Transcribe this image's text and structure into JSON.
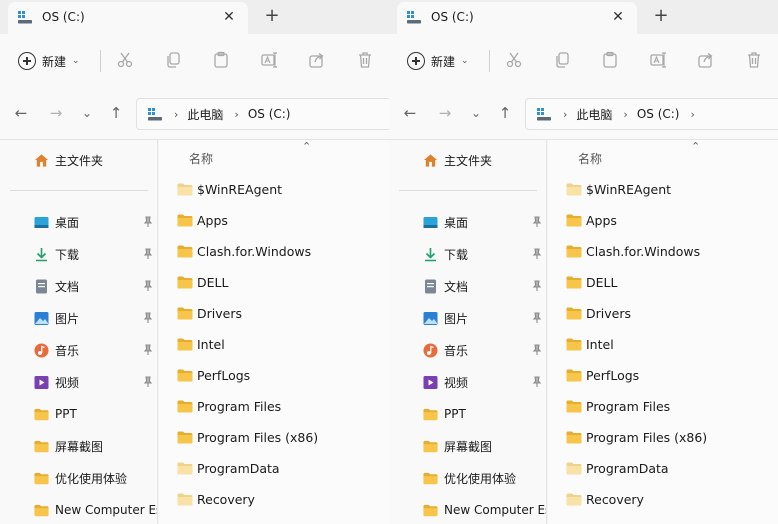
{
  "windows": [
    {
      "tab": {
        "title": "OS (C:)"
      },
      "toolbar": {
        "new_label": "新建"
      },
      "address": {
        "pc": "此电脑",
        "drive": "OS (C:)",
        "trailing_chevron": false
      },
      "sidebar": {
        "home": "主文件夹",
        "pinned": [
          {
            "label": "桌面",
            "icon": "desktop-icon"
          },
          {
            "label": "下载",
            "icon": "download-icon"
          },
          {
            "label": "文档",
            "icon": "document-icon"
          },
          {
            "label": "图片",
            "icon": "picture-icon"
          },
          {
            "label": "音乐",
            "icon": "music-icon"
          },
          {
            "label": "视频",
            "icon": "video-icon"
          }
        ],
        "folders": [
          "PPT",
          "屏幕截图",
          "优化使用体验",
          "New Computer Es"
        ]
      },
      "list": {
        "header": "名称",
        "items": [
          "$WinREAgent",
          "Apps",
          "Clash.for.Windows",
          "DELL",
          "Drivers",
          "Intel",
          "PerfLogs",
          "Program Files",
          "Program Files (x86)",
          "ProgramData",
          "Recovery"
        ]
      }
    },
    {
      "tab": {
        "title": "OS (C:)"
      },
      "toolbar": {
        "new_label": "新建"
      },
      "address": {
        "pc": "此电脑",
        "drive": "OS (C:)",
        "trailing_chevron": true
      },
      "sidebar": {
        "home": "主文件夹",
        "pinned": [
          {
            "label": "桌面",
            "icon": "desktop-icon"
          },
          {
            "label": "下载",
            "icon": "download-icon"
          },
          {
            "label": "文档",
            "icon": "document-icon"
          },
          {
            "label": "图片",
            "icon": "picture-icon"
          },
          {
            "label": "音乐",
            "icon": "music-icon"
          },
          {
            "label": "视频",
            "icon": "video-icon"
          }
        ],
        "folders": [
          "PPT",
          "屏幕截图",
          "优化使用体验",
          "New Computer Es"
        ]
      },
      "list": {
        "header": "名称",
        "items": [
          "$WinREAgent",
          "Apps",
          "Clash.for.Windows",
          "DELL",
          "Drivers",
          "Intel",
          "PerfLogs",
          "Program Files",
          "Program Files (x86)",
          "ProgramData",
          "Recovery"
        ]
      }
    }
  ],
  "colors": {
    "folder": "#f2c24c",
    "folder_light": "#f7d98a",
    "desktop": "#29a3d8",
    "download": "#1d9e6b",
    "picture": "#2b7fd4",
    "music": "#e96b3c",
    "video": "#7a3fb0",
    "home": "#e0812f"
  }
}
